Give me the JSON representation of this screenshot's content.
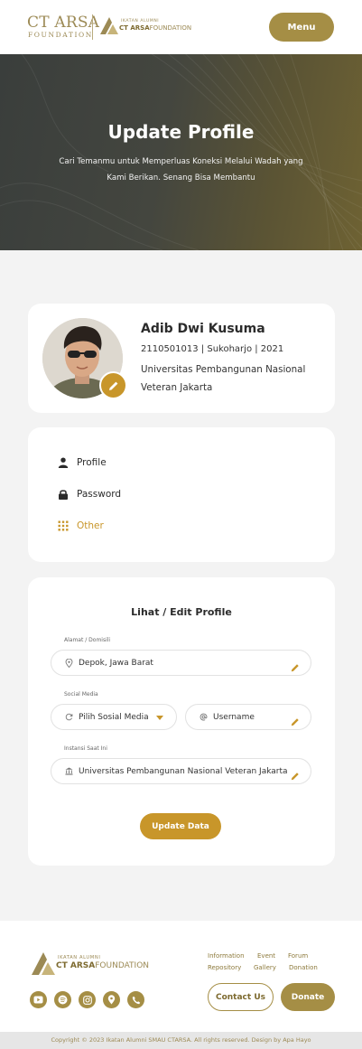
{
  "header": {
    "logo_main": "CT ARSA",
    "logo_sub": "FOUNDATION",
    "logo2_top": "IKATAN ALUMNI",
    "logo2_brand": "CT ARSA",
    "logo2_rest": "FOUNDATION",
    "menu_label": "Menu"
  },
  "hero": {
    "title": "Update Profile",
    "subtitle": "Cari Temanmu untuk Memperluas Koneksi Melalui Wadah yang Kami Berikan. Senang  Bisa Membantu"
  },
  "profile": {
    "name": "Adib Dwi Kusuma",
    "meta": "2110501013 | Sukoharjo | 2021",
    "university": "Universitas Pembangunan Nasional Veteran Jakarta"
  },
  "nav": {
    "items": [
      {
        "label": "Profile",
        "icon": "user-icon"
      },
      {
        "label": "Password",
        "icon": "lock-icon"
      },
      {
        "label": "Other",
        "icon": "grid-icon",
        "active": true
      }
    ]
  },
  "form": {
    "title": "Lihat / Edit Profile",
    "address_label": "Alamat / Domisili",
    "address_value": "Depok, Jawa Barat",
    "social_label": "Social Media",
    "social_select": "Pilih Sosial Media",
    "username_value": "Username",
    "institution_label": "Instansi Saat Ini",
    "institution_value": "Universitas Pembangunan Nasional Veteran Jakarta",
    "submit_label": "Update Data"
  },
  "footer": {
    "logo_top": "IKATAN ALUMNI",
    "logo_brand": "CT ARSA",
    "logo_rest": "FOUNDATION",
    "links": [
      "Information",
      "Event",
      "Forum",
      "Repository",
      "Gallery",
      "Donation"
    ],
    "social_icons": [
      "youtube-icon",
      "spotify-icon",
      "instagram-icon",
      "location-icon",
      "phone-icon"
    ],
    "contact_label": "Contact Us",
    "donate_label": "Donate",
    "copyright": "Copyright © 2023 Ikatan Alumni SMAU CTARSA. All rights reserved. Design by Apa Hayo"
  },
  "colors": {
    "gold": "#a58e45",
    "accent": "#c8962a",
    "background": "#f3f3f3"
  }
}
